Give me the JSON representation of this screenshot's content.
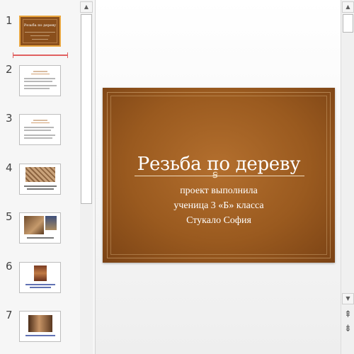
{
  "thumbnails": [
    {
      "number": "1",
      "title": "Резьба по дереву",
      "selected": true
    },
    {
      "number": "2",
      "heading": "Цели проекта"
    },
    {
      "number": "3",
      "heading": "Задачи проекта"
    },
    {
      "number": "4"
    },
    {
      "number": "5"
    },
    {
      "number": "6"
    },
    {
      "number": "7"
    }
  ],
  "slide": {
    "title": "Резьба по дереву",
    "ornament": "ꞩ",
    "lines": [
      "проект выполнила",
      "ученица 3 «Б» класса",
      "Стукало София"
    ]
  },
  "scroll": {
    "up": "▲",
    "down": "▼",
    "prev_slide": "⇞",
    "next_slide": "⇟"
  },
  "colors": {
    "slide_brown": "#9a5a1f",
    "selection": "#e9a640",
    "insert_marker": "#e06060"
  }
}
